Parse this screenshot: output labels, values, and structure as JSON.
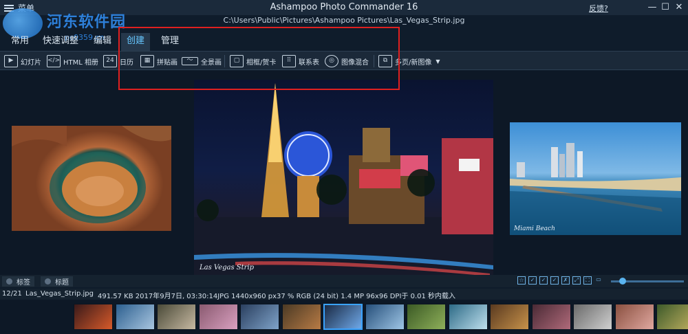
{
  "window": {
    "menu_label": "菜单",
    "app_title": "Ashampoo Photo Commander 16",
    "feedback_label": "反馈?",
    "file_path": "C:\\Users\\Public\\Pictures\\Ashampoo Pictures\\Las_Vegas_Strip.jpg",
    "minimize": "—",
    "maximize": "☐",
    "close": "✕"
  },
  "watermark": {
    "text": "河东软件园",
    "url": "pc0359.cn"
  },
  "tabs": [
    {
      "label": "常用"
    },
    {
      "label": "快速调整"
    },
    {
      "label": "编辑"
    },
    {
      "label": "创建",
      "active": true
    },
    {
      "label": "管理"
    }
  ],
  "toolbar": {
    "slideshow": "幻灯片",
    "html_album": "HTML 相册",
    "calendar_num": "24",
    "calendar": "日历",
    "collage": "拼贴画",
    "panorama": "全景画",
    "frame_card": "相框/贺卡",
    "contact_sheet": "联系表",
    "image_blend": "图像混合",
    "multipage": "多页/新图像"
  },
  "photos": {
    "main_signature": "Las Vegas Strip",
    "right_signature": "Miami Beach"
  },
  "tagbar": {
    "tags_label": "标签",
    "title_label": "标题"
  },
  "status": {
    "index": "12/21",
    "filename": "Las_Vegas_Strip.jpg",
    "details": "491.57 KB 2017年9月7日, 03:30:14JPG 1440x960 px37 %  RGB (24 bit)  1.4 MP 96x96 DPI于 0.01 秒内载入"
  },
  "zoom_level": 0.12,
  "colors": {
    "accent": "#3aa3ff",
    "highlight_box": "#e02020",
    "active_tab_text": "#66c7ff"
  },
  "thumbnails": [
    {
      "colors": [
        "#3a1a1a",
        "#d75a2a"
      ]
    },
    {
      "colors": [
        "#2c5f8f",
        "#a9c6e0"
      ]
    },
    {
      "colors": [
        "#4a4a38",
        "#c7b9a2"
      ]
    },
    {
      "colors": [
        "#8a5a70",
        "#d9a0c0"
      ]
    },
    {
      "colors": [
        "#2a3f5f",
        "#7fa3c9"
      ]
    },
    {
      "colors": [
        "#4b3a25",
        "#b87b45"
      ]
    },
    {
      "colors": [
        "#1a2a44",
        "#6fa8e8"
      ],
      "selected": true
    },
    {
      "colors": [
        "#264f7a",
        "#9fc6e6"
      ]
    },
    {
      "colors": [
        "#3b5a25",
        "#8fb05a"
      ]
    },
    {
      "colors": [
        "#2d6a86",
        "#bfe0ee"
      ]
    },
    {
      "colors": [
        "#5a3a20",
        "#c7924a"
      ]
    },
    {
      "colors": [
        "#4a2a35",
        "#b06a7a"
      ]
    },
    {
      "colors": [
        "#6a6a6a",
        "#d0d0d0"
      ]
    },
    {
      "colors": [
        "#8a5040",
        "#e0a8a0"
      ]
    },
    {
      "colors": [
        "#3d5a2a",
        "#c0b060"
      ]
    }
  ]
}
